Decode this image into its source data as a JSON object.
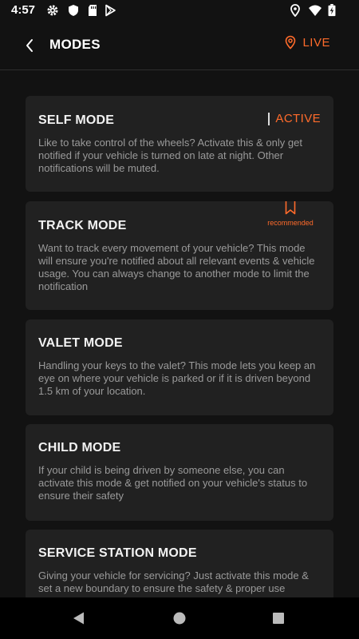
{
  "status_bar": {
    "time": "4:57",
    "icons": [
      "gear-icon",
      "shield-icon",
      "sd-card-icon",
      "play-store-icon",
      "location-icon",
      "wifi-icon",
      "battery-icon"
    ]
  },
  "header": {
    "title": "MODES",
    "live_label": "LIVE",
    "accent_color": "#ff6b2b"
  },
  "modes": [
    {
      "title": "SELF MODE",
      "status": "ACTIVE",
      "description": "Like to take control of the wheels? Activate this & only get notified if your vehicle is turned on late at night. Other notifications will be muted."
    },
    {
      "title": "TRACK MODE",
      "badge": "recommended",
      "description": "Want to track every movement of your vehicle? This mode will ensure you're notified about all relevant events & vehicle usage. You can always change to another mode to limit the notification"
    },
    {
      "title": "VALET MODE",
      "description": "Handling your keys to the valet? This mode lets you keep an eye on where your vehicle is parked or if it is driven beyond 1.5 km of your location."
    },
    {
      "title": "CHILD MODE",
      "description": "If your child is being driven by someone else, you can activate this mode & get notified on your vehicle's status to ensure their safety"
    },
    {
      "title": "SERVICE STATION MODE",
      "description": "Giving your vehicle for servicing? Just activate this mode & set a new boundary to ensure the safety & proper use"
    }
  ],
  "nav": {
    "icons": [
      "back-triangle-icon",
      "home-circle-icon",
      "recents-square-icon"
    ]
  }
}
